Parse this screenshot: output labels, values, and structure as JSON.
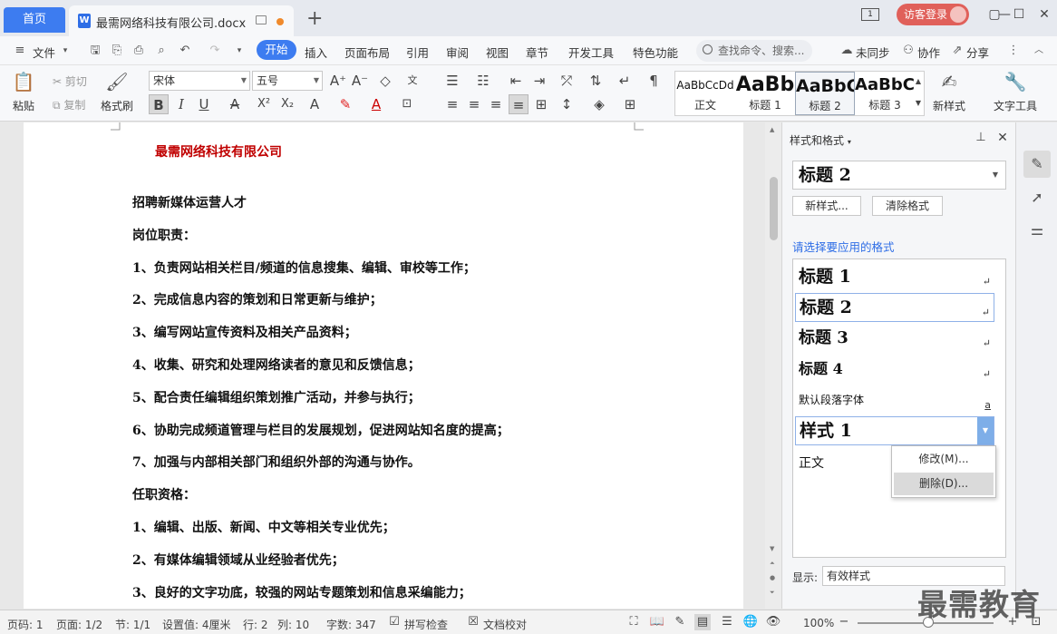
{
  "titlebar": {
    "home_tab": "首页",
    "doc_tab": "最需网络科技有限公司.docx",
    "doc_icon": "W",
    "add_tab": "+",
    "box_label": "1",
    "login": "访客登录"
  },
  "menu": {
    "file": "文件",
    "start": "开始",
    "items": [
      "插入",
      "页面布局",
      "引用",
      "审阅",
      "视图",
      "章节",
      "开发工具",
      "特色功能"
    ],
    "search_placeholder": "查找命令、搜索...",
    "unsync": "未同步",
    "collab": "协作",
    "share": "分享"
  },
  "ribbon": {
    "paste": "粘贴",
    "cut": "剪切",
    "copy": "复制",
    "format_painter": "格式刷",
    "font_name": "宋体",
    "font_size": "五号",
    "styles": [
      {
        "preview": "AaBbCcDd",
        "label": "正文"
      },
      {
        "preview": "AaBb",
        "label": "标题 1"
      },
      {
        "preview": "AaBbC",
        "label": "标题 2"
      },
      {
        "preview": "AaBbC",
        "label": "标题 3"
      }
    ],
    "new_style": "新样式",
    "text_tools": "文字工具"
  },
  "document": {
    "company": "最需网络科技有限公司",
    "lines": [
      "招聘新媒体运营人才",
      "岗位职责：",
      "1、负责网站相关栏目/频道的信息搜集、编辑、审校等工作；",
      "2、完成信息内容的策划和日常更新与维护；",
      "3、编写网站宣传资料及相关产品资料；",
      "4、收集、研究和处理网络读者的意见和反馈信息；",
      "5、配合责任编辑组织策划推广活动，并参与执行；",
      "6、协助完成频道管理与栏目的发展规划，促进网站知名度的提高；",
      "7、加强与内部相关部门和组织外部的沟通与协作。",
      "任职资格：",
      "1、编辑、出版、新闻、中文等相关专业优先；",
      "2、有媒体编辑领域从业经验者优先；",
      "3、良好的文字功底，较强的网站专题策划和信息采编能力；"
    ]
  },
  "panel": {
    "title": "样式和格式",
    "current": "标题 2",
    "new_style_btn": "新样式...",
    "clear_btn": "清除格式",
    "subtitle": "请选择要应用的格式",
    "styles": [
      "标题 1",
      "标题 2",
      "标题 3",
      "标题 4",
      "默认段落字体",
      "样式 1",
      "正文"
    ],
    "return_mark": "↵",
    "font_mark": "a",
    "context_menu": [
      "修改(M)...",
      "删除(D)..."
    ],
    "show_label": "显示:",
    "show_value": "有效样式"
  },
  "status": {
    "page_num": "页码: 1",
    "pages": "页面: 1/2",
    "section": "节: 1/1",
    "setting": "设置值: 4厘米",
    "row": "行: 2",
    "col": "列: 10",
    "words": "字数: 347",
    "spell": "拼写检查",
    "proof": "文档校对",
    "zoom": "100%",
    "zoom_fraction": 0.52
  },
  "watermark": "最需教育"
}
